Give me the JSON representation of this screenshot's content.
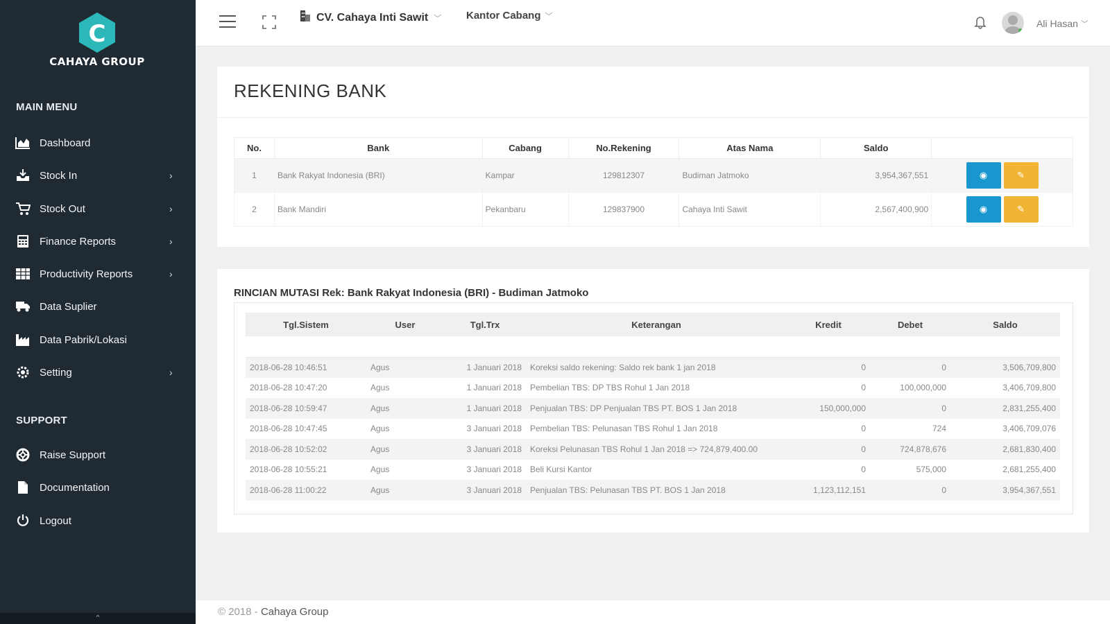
{
  "brand": {
    "name": "CAHAYA GROUP",
    "logo_letter": "C",
    "accent": "#2cb8b8"
  },
  "sidebar": {
    "main_heading": "MAIN MENU",
    "main_items": [
      {
        "label": "Dashboard",
        "icon": "chart-area-icon",
        "has_submenu": false
      },
      {
        "label": "Stock In",
        "icon": "inbox-download-icon",
        "has_submenu": true
      },
      {
        "label": "Stock Out",
        "icon": "cart-icon",
        "has_submenu": true
      },
      {
        "label": "Finance Reports",
        "icon": "calculator-icon",
        "has_submenu": true
      },
      {
        "label": "Productivity Reports",
        "icon": "table-icon",
        "has_submenu": true
      },
      {
        "label": "Data Suplier",
        "icon": "truck-icon",
        "has_submenu": false
      },
      {
        "label": "Data Pabrik/Lokasi",
        "icon": "factory-icon",
        "has_submenu": false
      },
      {
        "label": "Setting",
        "icon": "gear-icon",
        "has_submenu": true
      }
    ],
    "support_heading": "SUPPORT",
    "support_items": [
      {
        "label": "Raise Support",
        "icon": "lifebuoy-icon"
      },
      {
        "label": "Documentation",
        "icon": "document-icon"
      },
      {
        "label": "Logout",
        "icon": "power-icon"
      }
    ],
    "caret": "›"
  },
  "topbar": {
    "company": "CV. Cahaya Inti Sawit",
    "office": "Kantor Cabang",
    "user": "Ali Hasan"
  },
  "bank": {
    "title": "REKENING BANK",
    "headers": [
      "No.",
      "Bank",
      "Cabang",
      "No.Rekening",
      "Atas Nama",
      "Saldo",
      ""
    ],
    "rows": [
      {
        "no": "1",
        "bank": "Bank Rakyat Indonesia (BRI)",
        "cabang": "Kampar",
        "rekening": "129812307",
        "nama": "Budiman Jatmoko",
        "saldo": "3,954,367,551"
      },
      {
        "no": "2",
        "bank": "Bank Mandiri",
        "cabang": "Pekanbaru",
        "rekening": "129837900",
        "nama": "Cahaya Inti Sawit",
        "saldo": "2,567,400,900"
      }
    ],
    "view_color": "#1a96cf",
    "edit_color": "#f2b533"
  },
  "mutasi": {
    "title": "RINCIAN MUTASI Rek: Bank Rakyat Indonesia (BRI) - Budiman Jatmoko",
    "headers": [
      "Tgl.Sistem",
      "User",
      "Tgl.Trx",
      "Keterangan",
      "Kredit",
      "Debet",
      "Saldo"
    ],
    "rows": [
      [
        "2018-06-28 10:46:51",
        "Agus",
        "1 Januari 2018",
        "Koreksi saldo rekening: Saldo rek bank 1 jan 2018",
        "0",
        "0",
        "3,506,709,800"
      ],
      [
        "2018-06-28 10:47:20",
        "Agus",
        "1 Januari 2018",
        "Pembelian TBS: DP TBS Rohul 1 Jan 2018",
        "0",
        "100,000,000",
        "3,406,709,800"
      ],
      [
        "2018-06-28 10:59:47",
        "Agus",
        "1 Januari 2018",
        "Penjualan TBS: DP Penjualan TBS PT. BOS 1 Jan 2018",
        "150,000,000",
        "0",
        "2,831,255,400"
      ],
      [
        "2018-06-28 10:47:45",
        "Agus",
        "3 Januari 2018",
        "Pembelian TBS: Pelunasan TBS Rohul 1 Jan 2018",
        "0",
        "724",
        "3,406,709,076"
      ],
      [
        "2018-06-28 10:52:02",
        "Agus",
        "3 Januari 2018",
        "Koreksi Pelunasan TBS Rohul 1 Jan 2018 => 724,879,400.00",
        "0",
        "724,878,676",
        "2,681,830,400"
      ],
      [
        "2018-06-28 10:55:21",
        "Agus",
        "3 Januari 2018",
        "Beli Kursi Kantor",
        "0",
        "575,000",
        "2,681,255,400"
      ],
      [
        "2018-06-28 11:00:22",
        "Agus",
        "3 Januari 2018",
        "Penjualan TBS: Pelunasan TBS PT. BOS 1 Jan 2018",
        "1,123,112,151",
        "0",
        "3,954,367,551"
      ]
    ]
  },
  "footer": {
    "copyright": "© 2018 -",
    "company": "Cahaya Group"
  }
}
